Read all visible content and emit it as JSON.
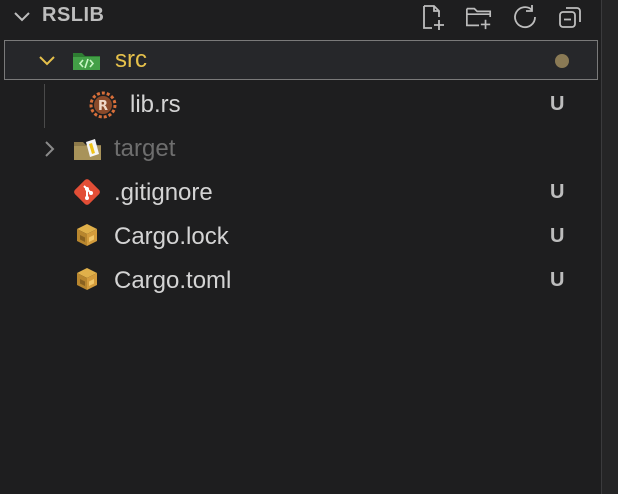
{
  "explorer": {
    "title": "RSLIB",
    "actions": [
      "new-file-icon",
      "new-folder-icon",
      "refresh-icon",
      "collapse-all-icon"
    ]
  },
  "tree": {
    "src": {
      "label": "src",
      "color": "#e5c04b",
      "expanded": true,
      "status": "modified-dot"
    },
    "lib_rs": {
      "label": "lib.rs",
      "status": "U"
    },
    "target": {
      "label": "target",
      "color": "#6e6e6e",
      "expanded": false
    },
    "gitignore": {
      "label": ".gitignore",
      "status": "U"
    },
    "cargo_lock": {
      "label": "Cargo.lock",
      "status": "U"
    },
    "cargo_toml": {
      "label": "Cargo.toml",
      "status": "U"
    }
  },
  "colors": {
    "background": "#1e1e1f",
    "text": "#d4d4d4",
    "folder_accent": "#e5c04b",
    "dimmed": "#6e6e6e",
    "git_icon": "#e24e36"
  }
}
